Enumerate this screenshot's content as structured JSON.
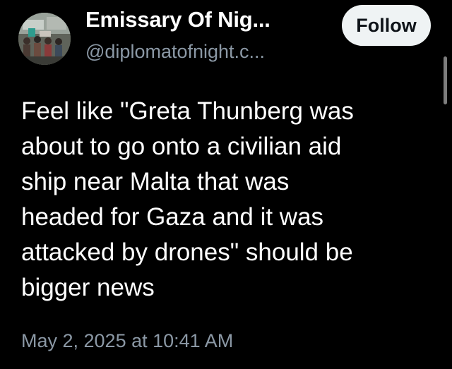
{
  "author": {
    "display_name": "Emissary Of Nig...",
    "handle": "@diplomatofnight.c..."
  },
  "header": {
    "follow_label": "Follow"
  },
  "post": {
    "text_lines": [
      "Feel like \"Greta Thunberg was",
      "about to go onto a civilian aid",
      "ship near Malta that was",
      "headed for Gaza and it was",
      "attacked by drones\" should be",
      "bigger news"
    ],
    "timestamp": "May 2, 2025 at 10:41 AM"
  },
  "colors": {
    "background": "#000000",
    "primary_text": "#ffffff",
    "secondary_text": "#8b98a5",
    "follow_button_bg": "#eff3f4",
    "follow_button_text": "#0f1419"
  },
  "icons": {
    "avatar": "profile-photo-crowd"
  }
}
